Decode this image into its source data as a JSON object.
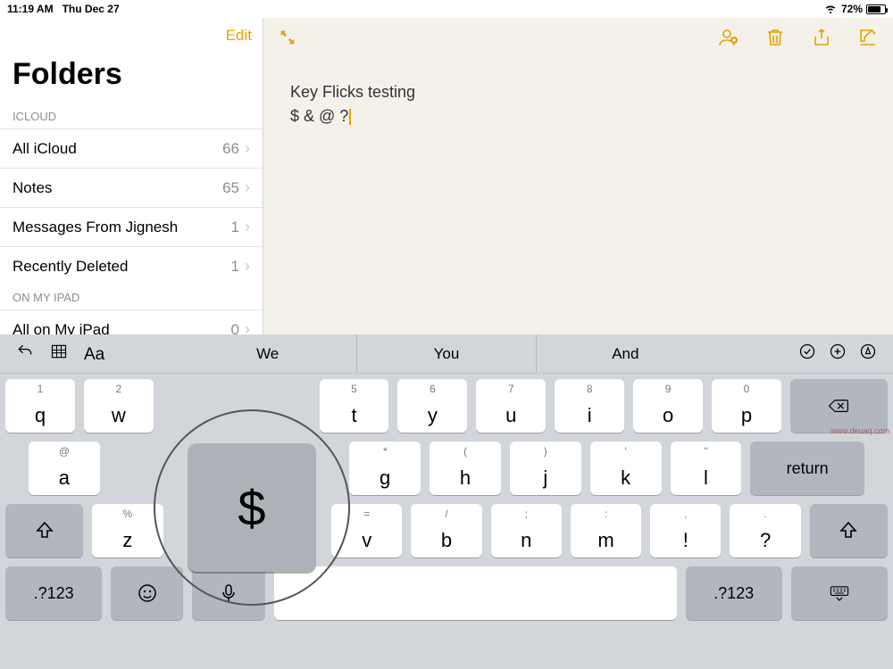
{
  "status": {
    "time": "11:19 AM",
    "date": "Thu Dec 27",
    "battery_pct": "72%"
  },
  "sidebar": {
    "edit": "Edit",
    "title": "Folders",
    "section_icloud": "ICLOUD",
    "section_ipad": "ON MY IPAD",
    "items": [
      {
        "label": "All iCloud",
        "count": "66"
      },
      {
        "label": "Notes",
        "count": "65"
      },
      {
        "label": "Messages From Jignesh",
        "count": "1"
      },
      {
        "label": "Recently Deleted",
        "count": "1"
      }
    ],
    "ipad_items": [
      {
        "label": "All on My iPad",
        "count": "0"
      }
    ]
  },
  "note": {
    "line1": "Key Flicks testing",
    "line2": "$ & @ ?"
  },
  "keyboard": {
    "sugg": [
      "We",
      "You",
      "And"
    ],
    "format_label": "Aa",
    "row1": [
      {
        "main": "q",
        "alt": "1"
      },
      {
        "main": "w",
        "alt": "2"
      },
      {
        "main": "",
        "alt": ""
      },
      {
        "main": "",
        "alt": ""
      },
      {
        "main": "t",
        "alt": "5"
      },
      {
        "main": "y",
        "alt": "6"
      },
      {
        "main": "u",
        "alt": "7"
      },
      {
        "main": "i",
        "alt": "8"
      },
      {
        "main": "o",
        "alt": "9"
      },
      {
        "main": "p",
        "alt": "0"
      }
    ],
    "row2": [
      {
        "main": "a",
        "alt": "@"
      },
      {
        "main": "",
        "alt": ""
      },
      {
        "main": "",
        "alt": ""
      },
      {
        "main": "",
        "alt": ""
      },
      {
        "main": "g",
        "alt": "*"
      },
      {
        "main": "h",
        "alt": "("
      },
      {
        "main": "j",
        "alt": ")"
      },
      {
        "main": "k",
        "alt": "'"
      },
      {
        "main": "l",
        "alt": "\""
      }
    ],
    "return": "return",
    "row3": [
      {
        "main": "z",
        "alt": "%"
      },
      {
        "main": "",
        "alt": ""
      },
      {
        "main": "",
        "alt": ""
      },
      {
        "main": "v",
        "alt": "="
      },
      {
        "main": "b",
        "alt": "/"
      },
      {
        "main": "n",
        "alt": ";"
      },
      {
        "main": "m",
        "alt": ":"
      },
      {
        "main": "!",
        "alt": ","
      },
      {
        "main": "?",
        "alt": "."
      }
    ],
    "mode_label": ".?123",
    "pressed_key": "$"
  },
  "watermark": "www.deuaq.com"
}
